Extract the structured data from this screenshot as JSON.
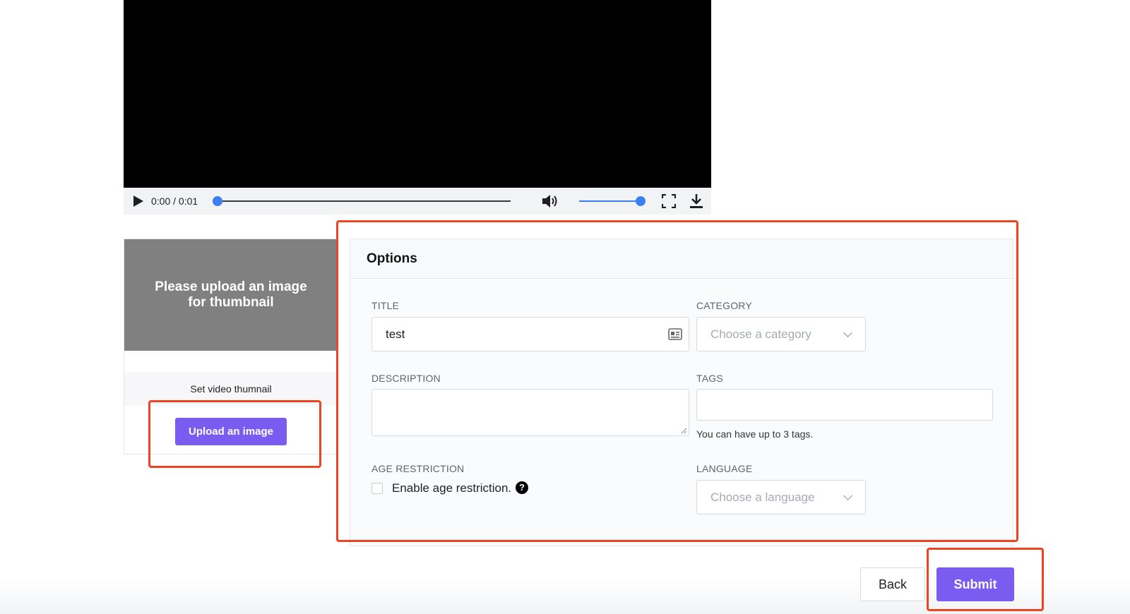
{
  "player": {
    "time": "0:00 / 0:01",
    "progress": 0,
    "volume": 1
  },
  "thumbnail": {
    "placeholder_text": "Please upload an image for thumbnail",
    "caption": "Set video thumnail",
    "upload_label": "Upload an image"
  },
  "options": {
    "heading": "Options",
    "title": {
      "label": "TITLE",
      "value": "test"
    },
    "category": {
      "label": "CATEGORY",
      "placeholder": "Choose a category"
    },
    "description": {
      "label": "DESCRIPTION",
      "value": ""
    },
    "tags": {
      "label": "TAGS",
      "value": "",
      "hint": "You can have up to 3 tags."
    },
    "age_restriction": {
      "label": "AGE RESTRICTION",
      "checkbox_label": "Enable age restriction.",
      "checked": false,
      "help_glyph": "?"
    },
    "language": {
      "label": "LANGUAGE",
      "placeholder": "Choose a language"
    }
  },
  "footer": {
    "back_label": "Back",
    "submit_label": "Submit"
  },
  "colors": {
    "accent": "#7b5cf0",
    "highlight": "#ee4422",
    "slider": "#3e7ff0"
  },
  "icons": [
    "play-icon",
    "volume-icon",
    "fullscreen-icon",
    "download-icon",
    "id-card-icon",
    "chevron-down-icon",
    "help-icon"
  ]
}
